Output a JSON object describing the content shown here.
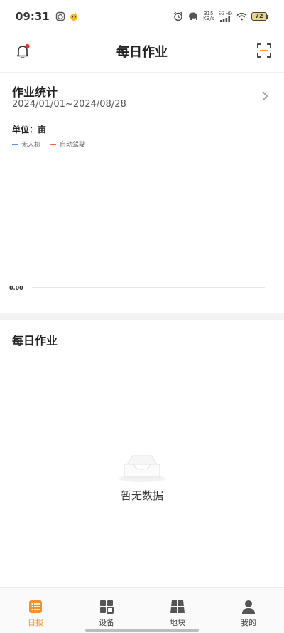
{
  "status_bar": {
    "time": "09:31",
    "net_speed_value": "315",
    "net_speed_unit": "KB/s",
    "signal_label": "5G HD",
    "battery": "72"
  },
  "header": {
    "title": "每日作业"
  },
  "stats": {
    "title": "作业统计",
    "date_range": "2024/01/01~2024/08/28",
    "unit_label": "单位：亩"
  },
  "chart_data": {
    "type": "line",
    "series": [
      {
        "name": "无人机",
        "color": "#5b8ff9",
        "values": []
      },
      {
        "name": "自动驾驶",
        "color": "#f4664a",
        "values": []
      }
    ],
    "y_tick_labels": [
      "0.00"
    ],
    "ylim": [
      0,
      0
    ]
  },
  "daily": {
    "title": "每日作业",
    "empty_text": "暂无数据"
  },
  "nav": {
    "items": [
      {
        "label": "日报",
        "icon": "list-icon",
        "active": true
      },
      {
        "label": "设备",
        "icon": "grid-icon",
        "active": false
      },
      {
        "label": "地块",
        "icon": "field-icon",
        "active": false
      },
      {
        "label": "我的",
        "icon": "user-icon",
        "active": false
      }
    ]
  },
  "colors": {
    "accent": "#f0932b",
    "notification_dot": "#e53935"
  }
}
